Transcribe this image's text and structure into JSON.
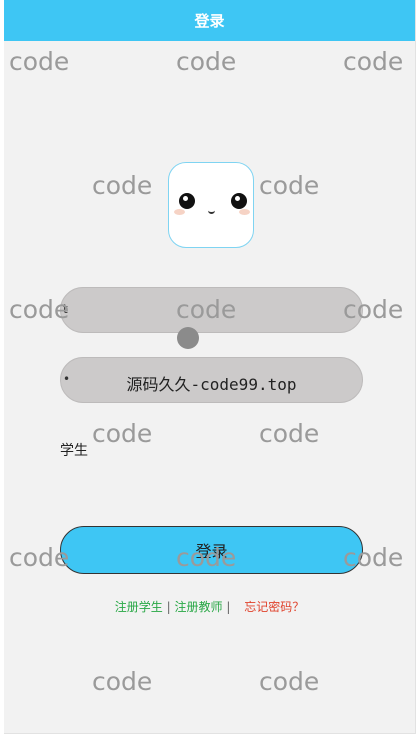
{
  "header": {
    "title": "登录"
  },
  "form": {
    "username_icon": "t",
    "password_icon": "•",
    "password_value": "源码久久-code99.top",
    "role_label": "学生"
  },
  "login_button": {
    "label": "登录"
  },
  "links": {
    "register_student": "注册学生",
    "separator1": "|",
    "register_teacher": "注册教师",
    "separator2": "|",
    "forgot_password": "忘记密码？"
  },
  "watermark": {
    "text": "code",
    "count": 16
  },
  "colors": {
    "accent": "#3ec6f4",
    "field_bg": "#cccaca",
    "link_green": "#28a745",
    "link_red": "#e0412b",
    "page_bg": "#f2f2f2"
  },
  "icons": {
    "avatar": "cute-face-avatar-icon"
  }
}
